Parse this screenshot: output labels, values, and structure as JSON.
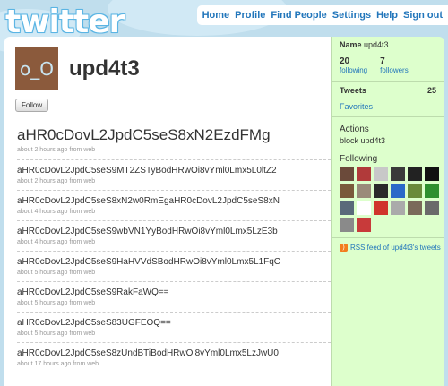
{
  "logo": "twitter",
  "nav": [
    "Home",
    "Profile",
    "Find People",
    "Settings",
    "Help",
    "Sign out"
  ],
  "profile": {
    "avatar_text": "o_O",
    "username": "upd4t3",
    "follow_label": "Follow"
  },
  "tweets": [
    {
      "text": "aHR0cDovL2JpdC5seS8xN2EzdFMg",
      "meta": "about 2 hours ago from web"
    },
    {
      "text": "aHR0cDovL2JpdC5seS9MT2ZSTyBodHRwOi8vYml0Lmx5L0ltZ2",
      "meta": "about 2 hours ago from web"
    },
    {
      "text": "aHR0cDovL2JpdC5seS8xN2w0RmEgaHR0cDovL2JpdC5seS8xN",
      "meta": "about 4 hours ago from web"
    },
    {
      "text": "aHR0cDovL2JpdC5seS9wbVN1YyBodHRwOi8vYml0Lmx5LzE3b",
      "meta": "about 4 hours ago from web"
    },
    {
      "text": "aHR0cDovL2JpdC5seS9HaHVVdSBodHRwOi8vYml0Lmx5L1FqC",
      "meta": "about 5 hours ago from web"
    },
    {
      "text": "aHR0cDovL2JpdC5seS9RakFaWQ==",
      "meta": "about 5 hours ago from web"
    },
    {
      "text": "aHR0cDovL2JpdC5seS83UGFEOQ==",
      "meta": "about 5 hours ago from web"
    },
    {
      "text": "aHR0cDovL2JpdC5seS8zUndBTiBodHRwOi8vYml0Lmx5LzJwU0",
      "meta": "about 17 hours ago from web"
    }
  ],
  "sidebar": {
    "name_label": "Name",
    "name_value": "upd4t3",
    "following_count": "20",
    "following_label": "following",
    "followers_count": "7",
    "followers_label": "followers",
    "tweets_label": "Tweets",
    "tweets_count": "25",
    "favorites_label": "Favorites",
    "actions_title": "Actions",
    "block_label": "block",
    "block_user": "upd4t3",
    "following_title": "Following",
    "rss_label": "RSS feed of upd4t3's tweets"
  },
  "following_avatars": [
    "#6b4a3a",
    "#b13a3a",
    "#c8c8c8",
    "#3a3a3a",
    "#222222",
    "#111111",
    "#7a5a3a",
    "#9a8a7a",
    "#2a2a2a",
    "#2a6ac8",
    "#6a8a3a",
    "#2f8f2f",
    "#5a6a7a",
    "#ffffff",
    "#d0342c",
    "#aaaaaa",
    "#7a6a5a",
    "#6a6a6a",
    "#8a8a8a",
    "#c83a3a"
  ]
}
